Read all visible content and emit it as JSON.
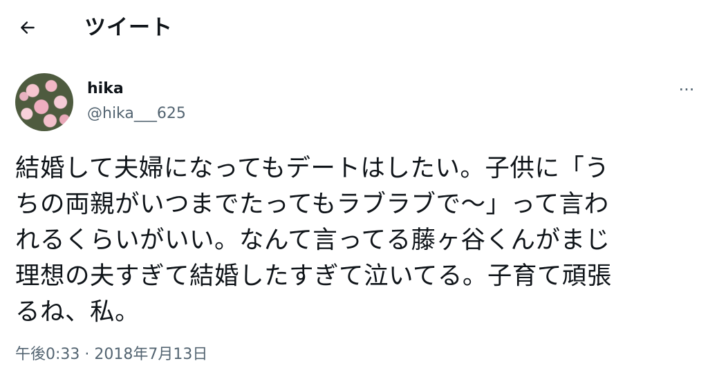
{
  "header": {
    "back_icon": "arrow-left-icon",
    "title": "ツイート"
  },
  "tweet": {
    "author": {
      "display_name": "hika",
      "handle": "@hika___625",
      "avatar_icon": "avatar-roses-photo"
    },
    "more_icon": "more-horizontal-icon",
    "more_label": "···",
    "text": "結婚して夫婦になってもデートはしたい。子供に「う\nちの両親がいつまでたってもラブラブで〜」って言わ\nれるくらいがいい。なんて言ってる藤ヶ谷くんがまじ\n理想の夫すぎて結婚したすぎて泣いてる。子育て頑張\nるね、私。",
    "timestamp": "午後0:33 · 2018年7月13日"
  }
}
